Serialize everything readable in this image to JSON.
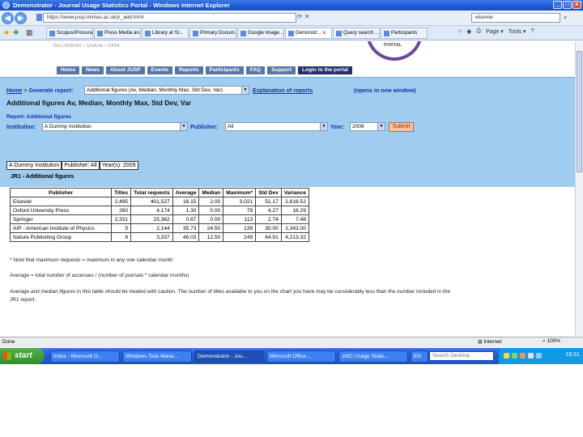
{
  "window": {
    "title": "Demonstrator - Journal Usage Statistics Portal - Windows Internet Explorer",
    "minimize": "_",
    "maximize": "□",
    "close": "x"
  },
  "address": {
    "url": "https://www.jusp.mimas.ac.uk/jr_add.html",
    "search": "elsevier"
  },
  "tabs": [
    "Scopus/Procura...",
    "Press Media an...",
    "Library at St...",
    "Primary Docum...",
    "Google Image...",
    "Demonstr...",
    "Query search ...",
    "Participants"
  ],
  "toolbar_right": [
    "Page ▾",
    "Tools ▾"
  ],
  "site": {
    "logo": "PORTAL",
    "tagline": "DELIVERING • USAGE • DATA",
    "nav": [
      "Home",
      "News",
      "About JUSP",
      "Events",
      "Reports",
      "Participants",
      "FAQ",
      "Support",
      "Login to the portal"
    ]
  },
  "breadcrumb": {
    "home": "Home",
    "sep": ">",
    "current": "Generate report:"
  },
  "report_select": "Additional figures (Av, Median, Monthly Max, Std Dev, Var)",
  "explain_link": "Explanation of reports",
  "explain_note": "(opens in new window)",
  "report_heading": "Additional figures    Av, Median, Monthly Max, Std Dev, Var",
  "report_label": "Report: Additional figures",
  "form": {
    "institution_label": "Institution:",
    "institution_value": "A Dummy Institution",
    "publisher_label": "Publisher:",
    "publisher_value": "All",
    "year_label": "Year:",
    "year_value": "2009",
    "submit": "Submit"
  },
  "filter_tabs": [
    "A Dummy Institution",
    "Publisher: All",
    "Year(s): 2009"
  ],
  "table_title": "JR1 - Additional figures",
  "table": {
    "headers": [
      "Publisher",
      "Titles",
      "Total requests",
      "Average",
      "Median",
      "Maximum*",
      "Std Dev",
      "Variance"
    ],
    "rows": [
      [
        "Elsevier",
        "2,495",
        "401,527",
        "16.15",
        "2.00",
        "3,021",
        "51.17",
        "2,618.52"
      ],
      [
        "Oxford University Press",
        "260",
        "4,174",
        "1.30",
        "0.00",
        "79",
        "4.27",
        "18.29"
      ],
      [
        "Springer",
        "2,331",
        "25,362",
        "0.87",
        "0.00",
        "113",
        "2.74",
        "7.48"
      ],
      [
        "AIP - American Institute of Physics",
        "5",
        "2,144",
        "35.73",
        "24.50",
        "139",
        "30.00",
        "1,343.00"
      ],
      [
        "Nature Publishing Group",
        "6",
        "3,337",
        "46.03",
        "12.50",
        "249",
        "64.91",
        "4,213.32"
      ]
    ]
  },
  "notes": {
    "n1": "* Note that maximum requests = maximum in any one calendar month",
    "n2": "Average = total number of accesses / (number of journals * calendar months)",
    "n3": "Average and median figures in this table should be treated with caution. The number of titles available to you on the chart you have may be considerably less than the number included in the",
    "n4": "JR1 report."
  },
  "status": {
    "text": "Done",
    "zone": "Internet",
    "zoom": "100%"
  },
  "taskbar": {
    "start": "start",
    "items": [
      "Inbox - Microsoft O...",
      "Windows Task Mana...",
      "Demonstrator - Jou...",
      "Microsoft Office...",
      "JISC Usage Statis...",
      "EN"
    ],
    "search": "Search Desktop",
    "clock": "16:51"
  }
}
